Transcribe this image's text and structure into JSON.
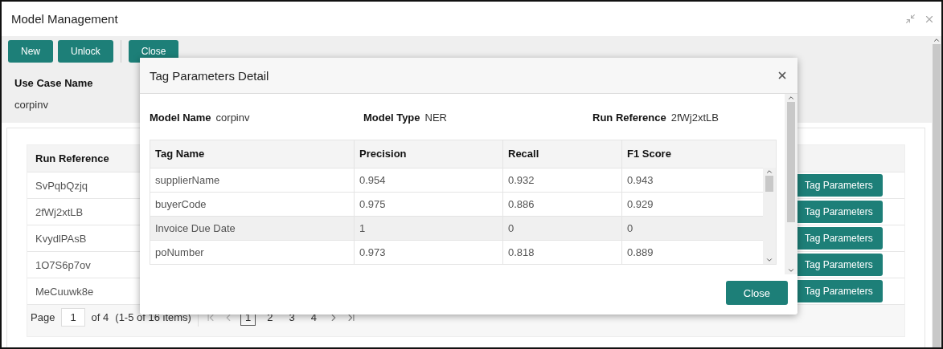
{
  "window": {
    "title": "Model Management"
  },
  "toolbar": {
    "buttons": [
      "New",
      "Unlock"
    ],
    "close_button": "Close"
  },
  "use_case": {
    "label": "Use Case Name",
    "value": "corpinv"
  },
  "runs_table": {
    "column": "Run Reference",
    "rows": [
      {
        "run_reference": "SvPqbQzjq",
        "action": "Tag Parameters"
      },
      {
        "run_reference": "2fWj2xtLB",
        "action": "Tag Parameters"
      },
      {
        "run_reference": "KvydlPAsB",
        "action": "Tag Parameters"
      },
      {
        "run_reference": "1O7S6p7ov",
        "action": "Tag Parameters"
      },
      {
        "run_reference": "MeCuuwk8e",
        "action": "Tag Parameters"
      }
    ]
  },
  "pagination": {
    "page_label": "Page",
    "page": "1",
    "total": "of 4",
    "summary": "(1-5 of 16 items)",
    "pages": [
      {
        "label": "1",
        "selected": true
      },
      {
        "label": "2",
        "selected": false
      },
      {
        "label": "3",
        "selected": false
      },
      {
        "label": "4",
        "selected": false
      }
    ]
  },
  "dialog": {
    "title": "Tag Parameters Detail",
    "fields": [
      {
        "label": "Model Name",
        "value": "corpinv"
      },
      {
        "label": "Model Type",
        "value": "NER"
      },
      {
        "label": "Run Reference",
        "value": "2fWj2xtLB"
      }
    ],
    "columns": [
      "Tag Name",
      "Precision",
      "Recall",
      "F1 Score"
    ],
    "rows": [
      {
        "cells": [
          "supplierName",
          "0.954",
          "0.932",
          "0.943"
        ],
        "selected": false
      },
      {
        "cells": [
          "buyerCode",
          "0.975",
          "0.886",
          "0.929"
        ],
        "selected": false
      },
      {
        "cells": [
          "Invoice Due Date",
          "1",
          "0",
          "0"
        ],
        "selected": true
      },
      {
        "cells": [
          "poNumber",
          "0.973",
          "0.818",
          "0.889"
        ],
        "selected": false
      }
    ],
    "button": "Close"
  }
}
